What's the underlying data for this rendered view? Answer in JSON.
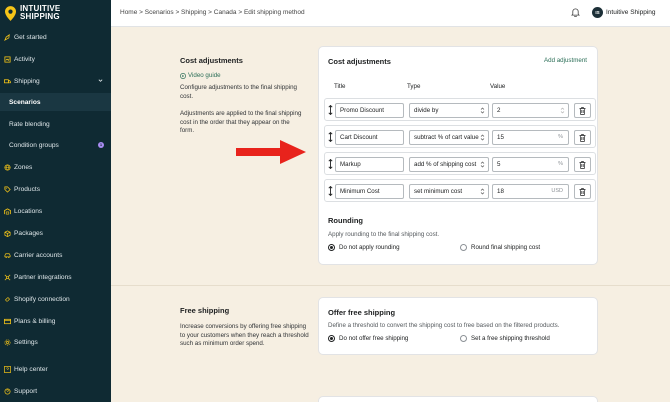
{
  "app": {
    "logo_line1": "INTUITIVE",
    "logo_line2": "SHIPPING"
  },
  "sidebar": {
    "items": [
      {
        "label": "Get started",
        "icon": "rocket-icon"
      },
      {
        "label": "Activity",
        "icon": "activity-icon"
      },
      {
        "label": "Shipping",
        "icon": "truck-icon"
      },
      {
        "label": "Scenarios"
      },
      {
        "label": "Rate blending"
      },
      {
        "label": "Condition groups",
        "badge": "1"
      },
      {
        "label": "Zones",
        "icon": "globe-icon"
      },
      {
        "label": "Products",
        "icon": "tag-icon"
      },
      {
        "label": "Locations",
        "icon": "warehouse-icon"
      },
      {
        "label": "Packages",
        "icon": "box-icon"
      },
      {
        "label": "Carrier accounts",
        "icon": "car-icon"
      },
      {
        "label": "Partner integrations",
        "icon": "plug-icon"
      },
      {
        "label": "Shopify connection",
        "icon": "link-icon"
      },
      {
        "label": "Plans & billing",
        "icon": "card-icon"
      },
      {
        "label": "Settings",
        "icon": "gear-icon"
      },
      {
        "label": "Help center",
        "icon": "help-icon"
      },
      {
        "label": "Support",
        "icon": "support-icon"
      }
    ]
  },
  "topbar": {
    "breadcrumb": "Home > Scenarios > Shipping > Canada > Edit shipping method",
    "avatar_initials": "IS",
    "shop_name": "Intuitive Shipping"
  },
  "cost_section": {
    "title": "Cost adjustments",
    "video_label": "Video guide",
    "desc1": "Configure adjustments to the final shipping cost.",
    "desc2": "Adjustments are applied to the final shipping cost in the order that they appear on the form."
  },
  "cost_card": {
    "title": "Cost adjustments",
    "add_label": "Add adjustment",
    "col_title": "Title",
    "col_type": "Type",
    "col_value": "Value",
    "rows": [
      {
        "title": "Promo Discount",
        "type": "divide by",
        "value": "2",
        "suffix": ""
      },
      {
        "title": "Cart Discount",
        "type": "subtract % of cart value",
        "value": "15",
        "suffix": "%"
      },
      {
        "title": "Markup",
        "type": "add % of shipping cost",
        "value": "5",
        "suffix": "%"
      },
      {
        "title": "Minimum Cost",
        "type": "set minimum cost",
        "value": "18",
        "suffix": "USD"
      }
    ],
    "rounding_title": "Rounding",
    "rounding_help": "Apply rounding to the final shipping cost.",
    "rounding_opt1": "Do not apply rounding",
    "rounding_opt2": "Round final shipping cost"
  },
  "free_section": {
    "title": "Free shipping",
    "desc": "Increase conversions by offering free shipping to your customers when they reach a threshold such as minimum order spend."
  },
  "free_card": {
    "title": "Offer free shipping",
    "help": "Define a threshold to convert the shipping cost to free based on the filtered products.",
    "opt1": "Do not offer free shipping",
    "opt2": "Set a free shipping threshold"
  },
  "colors": {
    "sidebar": "#0f2a33",
    "accent_green": "#2b6e57",
    "arrow_red": "#e8231c",
    "background": "#f6efe2"
  }
}
